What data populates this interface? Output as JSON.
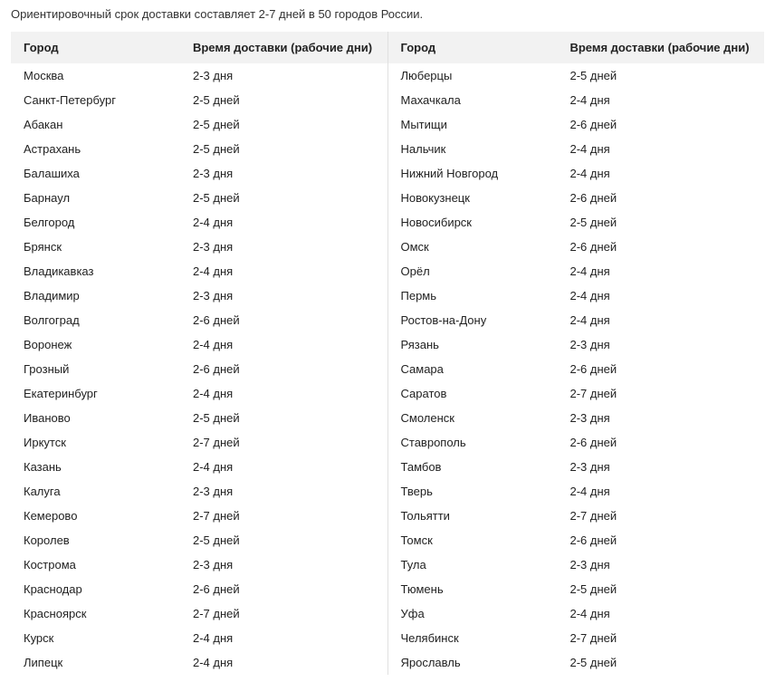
{
  "intro_text": "Ориентировочный срок доставки составляет 2-7 дней в 50 городов России.",
  "headers": {
    "city": "Город",
    "time": "Время доставки (рабочие дни)"
  },
  "left_rows": [
    {
      "city": "Москва",
      "time": "2-3 дня"
    },
    {
      "city": "Санкт-Петербург",
      "time": "2-5 дней"
    },
    {
      "city": "Абакан",
      "time": "2-5 дней"
    },
    {
      "city": "Астрахань",
      "time": "2-5 дней"
    },
    {
      "city": "Балашиха",
      "time": "2-3 дня"
    },
    {
      "city": "Барнаул",
      "time": "2-5 дней"
    },
    {
      "city": "Белгород",
      "time": "2-4 дня"
    },
    {
      "city": "Брянск",
      "time": "2-3 дня"
    },
    {
      "city": "Владикавказ",
      "time": "2-4 дня"
    },
    {
      "city": "Владимир",
      "time": "2-3 дня"
    },
    {
      "city": "Волгоград",
      "time": "2-6 дней"
    },
    {
      "city": "Воронеж",
      "time": "2-4 дня"
    },
    {
      "city": "Грозный",
      "time": "2-6 дней"
    },
    {
      "city": "Екатеринбург",
      "time": "2-4 дня"
    },
    {
      "city": "Иваново",
      "time": "2-5 дней"
    },
    {
      "city": "Иркутск",
      "time": "2-7 дней"
    },
    {
      "city": "Казань",
      "time": "2-4 дня"
    },
    {
      "city": "Калуга",
      "time": "2-3 дня"
    },
    {
      "city": "Кемерово",
      "time": "2-7 дней"
    },
    {
      "city": "Королев",
      "time": "2-5 дней"
    },
    {
      "city": "Кострома",
      "time": "2-3 дня"
    },
    {
      "city": "Краснодар",
      "time": "2-6 дней"
    },
    {
      "city": "Красноярск",
      "time": "2-7 дней"
    },
    {
      "city": "Курск",
      "time": "2-4 дня"
    },
    {
      "city": "Липецк",
      "time": "2-4 дня"
    }
  ],
  "right_rows": [
    {
      "city": "Люберцы",
      "time": "2-5 дней"
    },
    {
      "city": "Махачкала",
      "time": "2-4 дня"
    },
    {
      "city": "Мытищи",
      "time": "2-6 дней"
    },
    {
      "city": "Нальчик",
      "time": "2-4 дня"
    },
    {
      "city": "Нижний Новгород",
      "time": "2-4 дня"
    },
    {
      "city": "Новокузнецк",
      "time": "2-6 дней"
    },
    {
      "city": "Новосибирск",
      "time": "2-5 дней"
    },
    {
      "city": "Омск",
      "time": "2-6 дней"
    },
    {
      "city": "Орёл",
      "time": "2-4 дня"
    },
    {
      "city": "Пермь",
      "time": "2-4 дня"
    },
    {
      "city": "Ростов-на-Дону",
      "time": "2-4 дня"
    },
    {
      "city": "Рязань",
      "time": "2-3 дня"
    },
    {
      "city": "Самара",
      "time": "2-6 дней"
    },
    {
      "city": "Саратов",
      "time": "2-7 дней"
    },
    {
      "city": "Смоленск",
      "time": "2-3 дня"
    },
    {
      "city": "Ставрополь",
      "time": "2-6 дней"
    },
    {
      "city": "Тамбов",
      "time": "2-3 дня"
    },
    {
      "city": "Тверь",
      "time": "2-4 дня"
    },
    {
      "city": "Тольятти",
      "time": "2-7 дней"
    },
    {
      "city": "Томск",
      "time": "2-6 дней"
    },
    {
      "city": "Тула",
      "time": "2-3 дня"
    },
    {
      "city": "Тюмень",
      "time": "2-5 дней"
    },
    {
      "city": "Уфа",
      "time": "2-4 дня"
    },
    {
      "city": "Челябинск",
      "time": "2-7 дней"
    },
    {
      "city": "Ярославль",
      "time": "2-5 дней"
    }
  ]
}
